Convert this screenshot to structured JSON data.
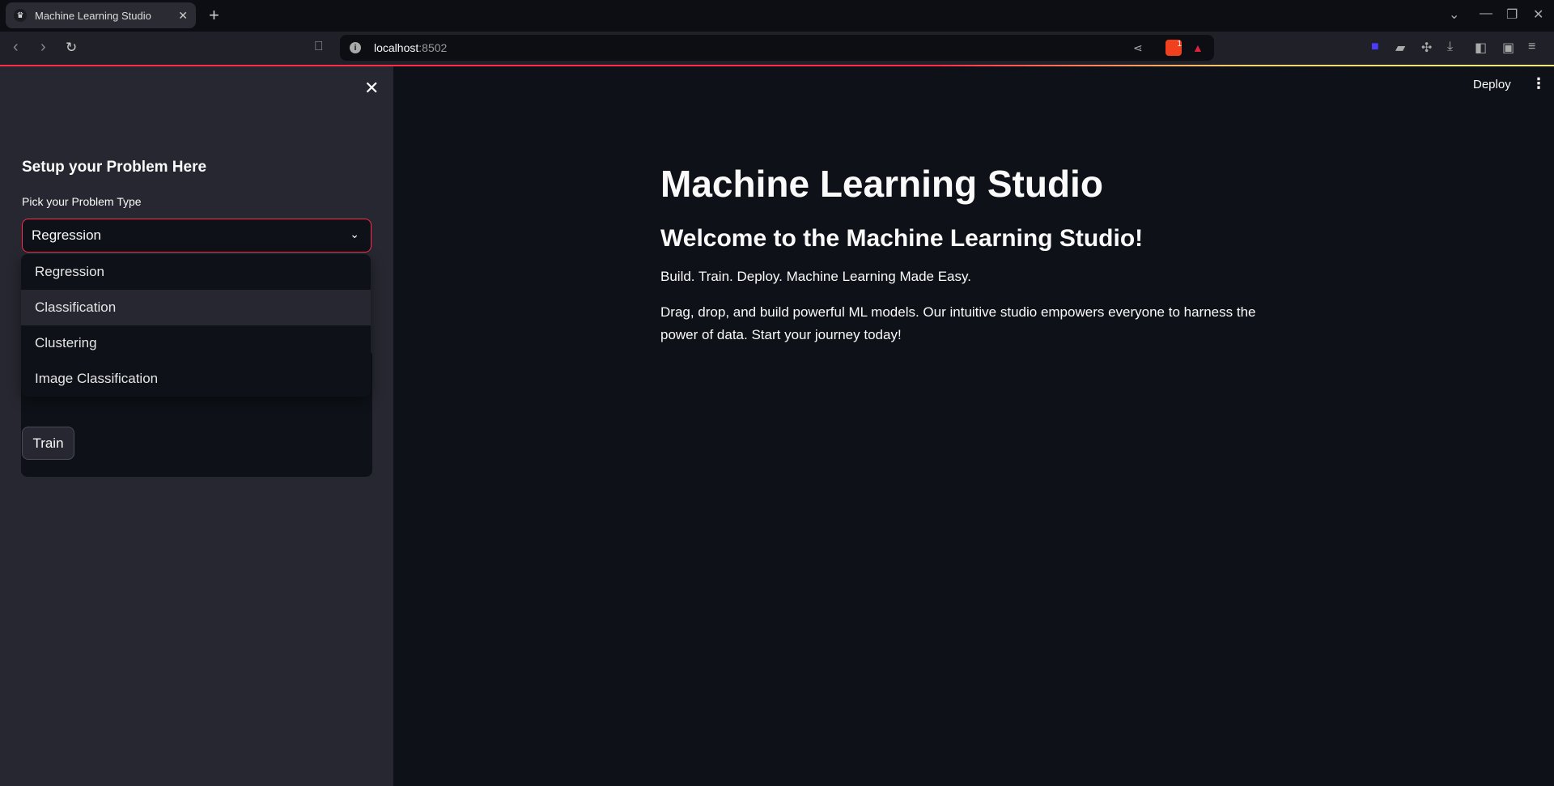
{
  "browser": {
    "tab_title": "Machine Learning Studio",
    "tab_favicon": "crown-icon",
    "url_host": "localhost",
    "url_port": ":8502",
    "extension_badge": "1"
  },
  "sidebar": {
    "heading": "Setup your Problem Here",
    "select_label": "Pick your Problem Type",
    "selected": "Regression",
    "options": [
      "Regression",
      "Classification",
      "Clustering",
      "Image Classification"
    ],
    "highlighted_option": "Classification",
    "train_label": "Train"
  },
  "header": {
    "deploy_label": "Deploy"
  },
  "main": {
    "title": "Machine Learning Studio",
    "subtitle": "Welcome to the Machine Learning Studio!",
    "tagline": "Build. Train. Deploy. Machine Learning Made Easy.",
    "description": "Drag, drop, and build powerful ML models. Our intuitive studio empowers everyone to harness the power of data. Start your journey today!"
  },
  "colors": {
    "accent": "#ff2b4a",
    "sidebar_bg": "#262730",
    "main_bg": "#0e1117"
  }
}
